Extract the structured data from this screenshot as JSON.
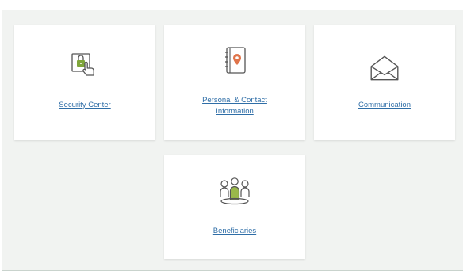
{
  "cards": [
    {
      "id": "security",
      "label": "Security Center",
      "icon": "security-lock-hand-icon"
    },
    {
      "id": "personal",
      "label_line1": "Personal & Contact",
      "label_line2": "Information",
      "icon": "address-book-location-icon"
    },
    {
      "id": "communication",
      "label": "Communication",
      "icon": "envelope-open-icon"
    },
    {
      "id": "beneficiaries",
      "label": "Beneficiaries",
      "icon": "people-group-icon"
    }
  ],
  "colors": {
    "link": "#2f6ea7",
    "accent_green": "#7fa63a",
    "accent_orange": "#e0744a",
    "icon_stroke": "#4d4d4d"
  }
}
